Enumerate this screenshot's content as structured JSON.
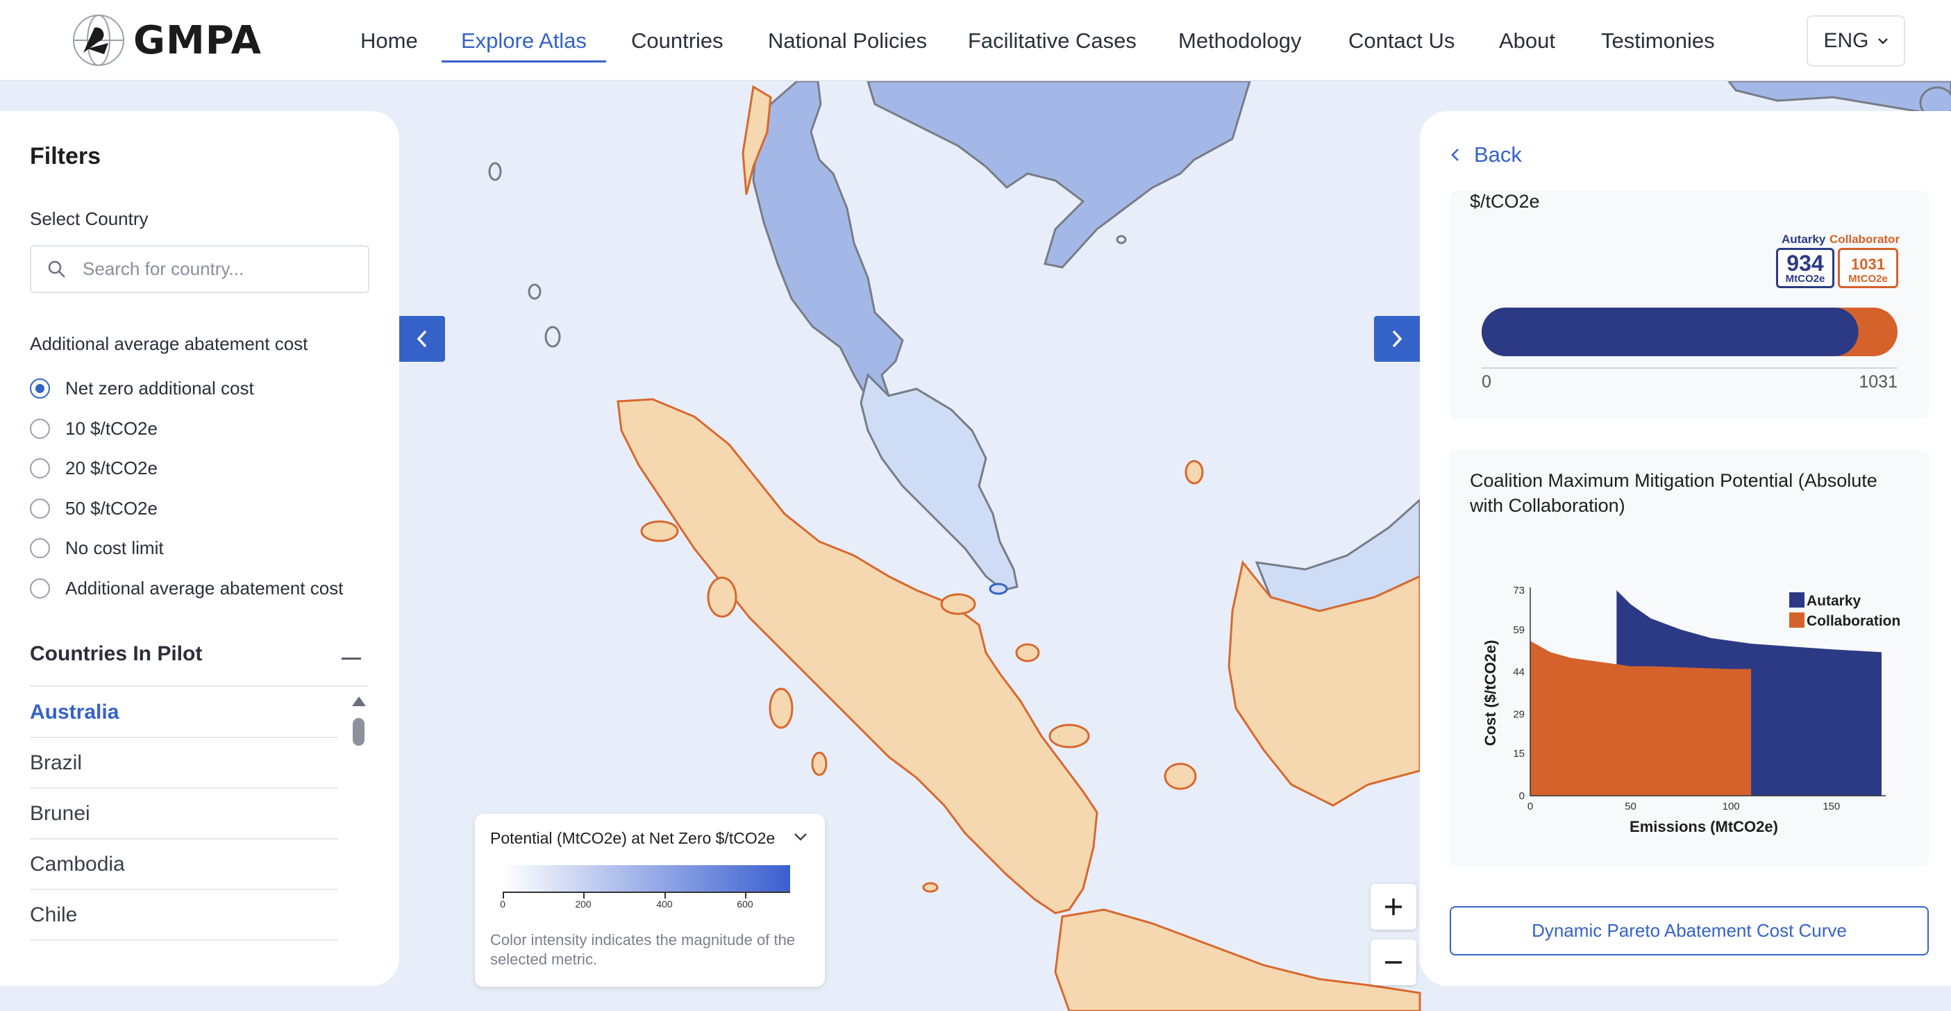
{
  "header": {
    "logo_text": "GMPA",
    "nav": [
      {
        "label": "Home",
        "active": false
      },
      {
        "label": "Explore Atlas",
        "active": true
      },
      {
        "label": "Countries",
        "active": false
      },
      {
        "label": "National Policies",
        "active": false
      },
      {
        "label": "Facilitative Cases",
        "active": false
      },
      {
        "label": "Methodology",
        "active": false
      },
      {
        "label": "Contact Us",
        "active": false
      },
      {
        "label": "About",
        "active": false
      },
      {
        "label": "Testimonies",
        "active": false
      }
    ],
    "language": "ENG"
  },
  "filters": {
    "title": "Filters",
    "select_country_label": "Select Country",
    "search_placeholder": "Search for country...",
    "cost_label": "Additional average abatement cost",
    "cost_options": [
      {
        "label": "Net zero additional cost",
        "checked": true
      },
      {
        "label": "10 $/tCO2e",
        "checked": false
      },
      {
        "label": "20 $/tCO2e",
        "checked": false
      },
      {
        "label": "50 $/tCO2e",
        "checked": false
      },
      {
        "label": "No cost limit",
        "checked": false
      },
      {
        "label": "Additional average abatement cost",
        "checked": false
      }
    ],
    "pilot_title": "Countries In Pilot",
    "countries": [
      "Australia",
      "Brazil",
      "Brunei",
      "Cambodia",
      "Chile"
    ],
    "active_country": "Australia"
  },
  "legend": {
    "title": "Potential (MtCO2e) at Net Zero $/tCO2e",
    "ticks": [
      "0",
      "200",
      "400",
      "600"
    ],
    "note": "Color intensity indicates the magnitude of the selected metric.",
    "colors": {
      "low": "#ffffff",
      "high": "#3a5fd0"
    }
  },
  "right_panel": {
    "back_label": "Back",
    "card1": {
      "cut_text": "$/tCO2e",
      "autarky_label": "Autarky",
      "collaborator_label": "Collaborator",
      "autarky_value": "934",
      "collaborator_value": "1031",
      "unit": "MtCO2e",
      "axis_min": "0",
      "axis_max": "1031"
    },
    "card2": {
      "title": "Coalition Maximum Mitigation Potential (Absolute with Collaboration)"
    },
    "pareto_button": "Dynamic Pareto Abatement Cost Curve"
  },
  "colors": {
    "accent": "#3562c8",
    "autarky": "#2c3a85",
    "collaboration": "#d5622a",
    "land_orange": "#f5d8b0",
    "land_orange_stroke": "#d8682e",
    "land_blue": "#a4b8e8",
    "land_light_blue": "#cfdcf5"
  },
  "chart_data": [
    {
      "type": "bar",
      "title": "",
      "categories": [
        "Autarky",
        "Collaborator"
      ],
      "series": [
        {
          "name": "Autarky",
          "values": [
            934
          ]
        },
        {
          "name": "Collaborator",
          "values": [
            1031
          ]
        }
      ],
      "unit": "MtCO2e",
      "xlim": [
        0,
        1031
      ],
      "orientation": "horizontal"
    },
    {
      "type": "area",
      "title": "Coalition Maximum Mitigation Potential (Absolute with Collaboration)",
      "xlabel": "Emissions (MtCO2e)",
      "ylabel": "Cost ($/tCO2e)",
      "xlim": [
        0,
        175
      ],
      "ylim": [
        0,
        73
      ],
      "x_ticks": [
        "0",
        "50",
        "100",
        "150"
      ],
      "y_ticks": [
        "0",
        "15",
        "29",
        "44",
        "59",
        "73"
      ],
      "legend": "top-right",
      "series": [
        {
          "name": "Autarky",
          "x": [
            43,
            43,
            50,
            60,
            75,
            90,
            110,
            130,
            150,
            175
          ],
          "y": [
            0,
            73,
            68,
            63,
            59,
            56,
            54,
            53,
            52,
            51
          ]
        },
        {
          "name": "Collaboration",
          "x": [
            0,
            0,
            5,
            10,
            20,
            30,
            40,
            50,
            60,
            80,
            100,
            110
          ],
          "y": [
            0,
            55,
            53,
            51,
            49,
            48,
            47,
            46,
            46,
            45.5,
            45,
            45
          ]
        }
      ]
    }
  ]
}
